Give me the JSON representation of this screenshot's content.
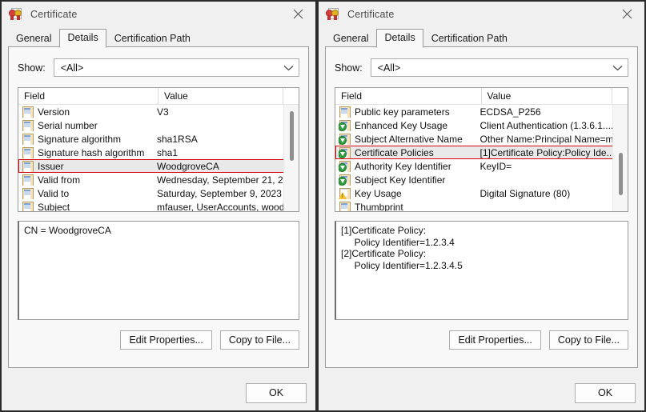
{
  "windows": [
    {
      "title": "Certificate",
      "icon": "certificate-icon",
      "close_glyph": "close-icon",
      "tabs": [
        {
          "label": "General",
          "active": false
        },
        {
          "label": "Details",
          "active": true
        },
        {
          "label": "Certification Path",
          "active": false
        }
      ],
      "show": {
        "label": "Show:",
        "value": "<All>",
        "chevron": "chevron-down-icon"
      },
      "list": {
        "headers": {
          "field": "Field",
          "value": "Value"
        },
        "scroll_thumb_top_pct": 6,
        "scroll_thumb_height_pct": 47,
        "rows": [
          {
            "icon": "doc",
            "field": "Version",
            "value": "V3",
            "selected": false,
            "clipped": false
          },
          {
            "icon": "doc",
            "field": "Serial number",
            "value": "",
            "selected": false,
            "clipped": false
          },
          {
            "icon": "doc",
            "field": "Signature algorithm",
            "value": "sha1RSA",
            "selected": false,
            "clipped": false
          },
          {
            "icon": "doc",
            "field": "Signature hash algorithm",
            "value": "sha1",
            "selected": false,
            "clipped": false
          },
          {
            "icon": "doc",
            "field": "Issuer",
            "value": "WoodgroveCA",
            "selected": true,
            "clipped": false
          },
          {
            "icon": "doc",
            "field": "Valid from",
            "value": "Wednesday, September 21, 2...",
            "selected": false,
            "clipped": false
          },
          {
            "icon": "doc",
            "field": "Valid to",
            "value": "Saturday, September 9, 2023 ...",
            "selected": false,
            "clipped": false
          },
          {
            "icon": "doc",
            "field": "Subject",
            "value": "mfauser, UserAccounts, wood",
            "selected": false,
            "clipped": true
          }
        ]
      },
      "detail_text": "CN = WoodgroveCA",
      "actions": [
        {
          "label": "Edit Properties..."
        },
        {
          "label": "Copy to File..."
        }
      ],
      "ok_label": "OK"
    },
    {
      "title": "Certificate",
      "icon": "certificate-icon",
      "close_glyph": "close-icon",
      "tabs": [
        {
          "label": "General",
          "active": false
        },
        {
          "label": "Details",
          "active": true
        },
        {
          "label": "Certification Path",
          "active": false
        }
      ],
      "show": {
        "label": "Show:",
        "value": "<All>",
        "chevron": "chevron-down-icon"
      },
      "list": {
        "headers": {
          "field": "Field",
          "value": "Value"
        },
        "scroll_thumb_top_pct": 45,
        "scroll_thumb_height_pct": 40,
        "rows": [
          {
            "icon": "doc",
            "field": "Public key parameters",
            "value": "ECDSA_P256",
            "selected": false,
            "clipped": false
          },
          {
            "icon": "ext",
            "field": "Enhanced Key Usage",
            "value": "Client Authentication (1.3.6.1....",
            "selected": false,
            "clipped": false
          },
          {
            "icon": "ext",
            "field": "Subject Alternative Name",
            "value": "Other Name:Principal Name=m...",
            "selected": false,
            "clipped": false
          },
          {
            "icon": "ext",
            "field": "Certificate Policies",
            "value": "[1]Certificate Policy:Policy Ide...",
            "selected": true,
            "clipped": false
          },
          {
            "icon": "ext",
            "field": "Authority Key Identifier",
            "value": "KeyID=",
            "selected": false,
            "clipped": false
          },
          {
            "icon": "ext",
            "field": "Subject Key Identifier",
            "value": "",
            "selected": false,
            "clipped": false
          },
          {
            "icon": "warn",
            "field": "Key Usage",
            "value": "Digital Signature (80)",
            "selected": false,
            "clipped": false
          },
          {
            "icon": "doc",
            "field": "Thumbprint",
            "value": "",
            "selected": false,
            "clipped": true
          }
        ]
      },
      "detail_text": "[1]Certificate Policy:\n     Policy Identifier=1.2.3.4\n[2]Certificate Policy:\n     Policy Identifier=1.2.3.4.5",
      "actions": [
        {
          "label": "Edit Properties..."
        },
        {
          "label": "Copy to File..."
        }
      ],
      "ok_label": "OK"
    }
  ],
  "colors": {
    "selection_outline": "#d6000f",
    "selection_fill": "#e9e9e9",
    "window_bg": "#f0f0f0",
    "panel_bg": "#f8f8f8",
    "field_bg": "#ffffff"
  }
}
